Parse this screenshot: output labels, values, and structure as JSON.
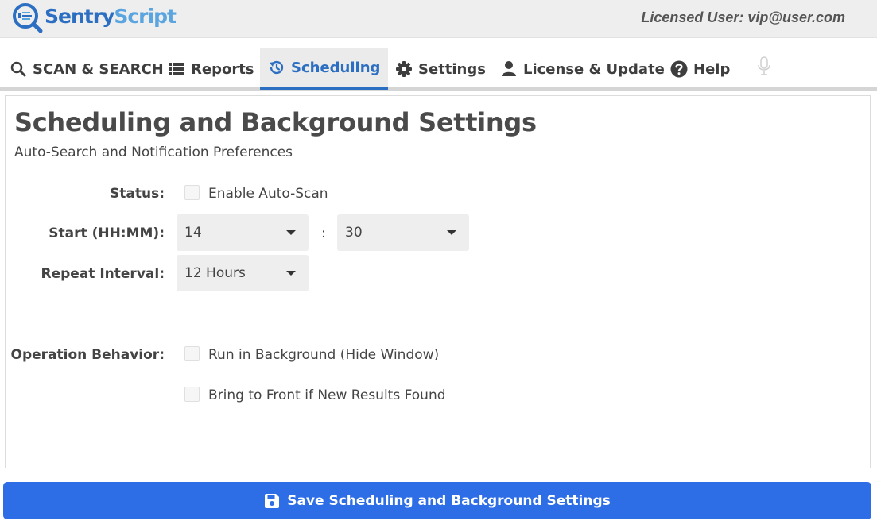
{
  "app": {
    "logo_part1": "Sentry",
    "logo_part2": "Script",
    "licensed_user": "Licensed User: vip@user.com"
  },
  "nav": {
    "tabs": [
      {
        "label": "SCAN & SEARCH",
        "icon": "search-icon"
      },
      {
        "label": "Reports",
        "icon": "list-icon"
      },
      {
        "label": "Scheduling",
        "icon": "history-icon",
        "active": true
      },
      {
        "label": "Settings",
        "icon": "gear-icon"
      },
      {
        "label": "License & Update",
        "icon": "user-icon"
      },
      {
        "label": "Help",
        "icon": "question-circle-icon"
      }
    ],
    "mic_icon": "microphone-icon"
  },
  "page": {
    "title": "Scheduling and Background Settings",
    "subtitle": "Auto-Search and Notification Preferences"
  },
  "form": {
    "status_label": "Status:",
    "enable_auto_scan": {
      "label": "Enable Auto-Scan",
      "checked": false
    },
    "start_label": "Start (HH:MM):",
    "start_hour": "14",
    "time_separator": ":",
    "start_minute": "30",
    "repeat_label": "Repeat Interval:",
    "repeat_value": "12 Hours",
    "behavior_label": "Operation Behavior:",
    "run_background": {
      "label": "Run in Background (Hide Window)",
      "checked": false
    },
    "bring_front": {
      "label": "Bring to Front if New Results Found",
      "checked": false
    }
  },
  "actions": {
    "save_label": "Save Scheduling and Background Settings",
    "save_icon": "floppy-disk-icon"
  },
  "colors": {
    "accent": "#2c6fc2",
    "save_button": "#2d6ee6"
  }
}
